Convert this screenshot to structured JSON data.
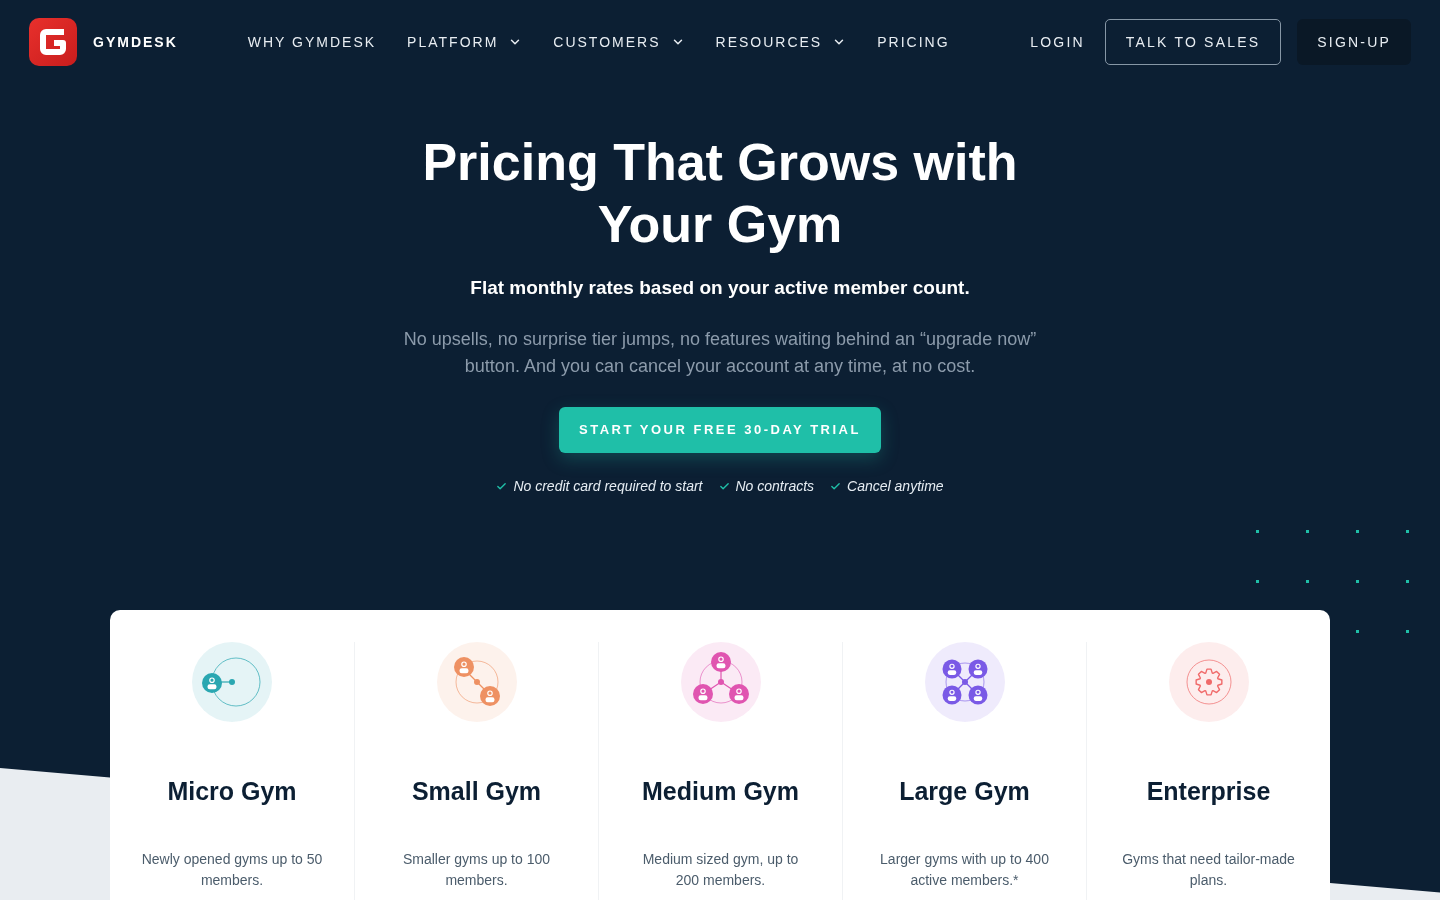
{
  "header": {
    "brand": "GYMDESK",
    "nav_items": [
      {
        "label": "WHY GYMDESK",
        "dropdown": false
      },
      {
        "label": "PLATFORM",
        "dropdown": true
      },
      {
        "label": "CUSTOMERS",
        "dropdown": true
      },
      {
        "label": "RESOURCES",
        "dropdown": true
      },
      {
        "label": "PRICING",
        "dropdown": false
      }
    ],
    "actions": [
      {
        "label": "LOGIN",
        "kind": "link"
      },
      {
        "label": "TALK TO SALES",
        "kind": "outline"
      },
      {
        "label": "SIGN-UP",
        "kind": "solid"
      }
    ]
  },
  "hero": {
    "title": "Pricing That Grows with Your Gym",
    "subtitle": "Flat monthly rates based on your active member count.",
    "description": "No upsells, no surprise tier jumps, no features waiting behind an “upgrade now” button. And you can cancel your account at any time, at no cost.",
    "cta": "START YOUR FREE 30-DAY TRIAL",
    "perks": [
      "No credit card required to start",
      "No contracts",
      "Cancel anytime"
    ]
  },
  "plans": [
    {
      "kind": "micro",
      "name": "Micro Gym",
      "description": "Newly opened gyms up to 50 members.",
      "color": "#2aa7b1"
    },
    {
      "kind": "small",
      "name": "Small Gym",
      "description": "Smaller gyms up to 100 members.",
      "color": "#ee9163"
    },
    {
      "kind": "medium",
      "name": "Medium Gym",
      "description": "Medium sized gym, up to 200 members.",
      "color": "#e055b0"
    },
    {
      "kind": "large",
      "name": "Large Gym",
      "description": "Larger gyms with up to 400 active members.*",
      "color": "#7a5ae6"
    },
    {
      "kind": "enterprise",
      "name": "Enterprise",
      "description": "Gyms that need tailor-made plans.",
      "color": "#f06a6a"
    }
  ]
}
